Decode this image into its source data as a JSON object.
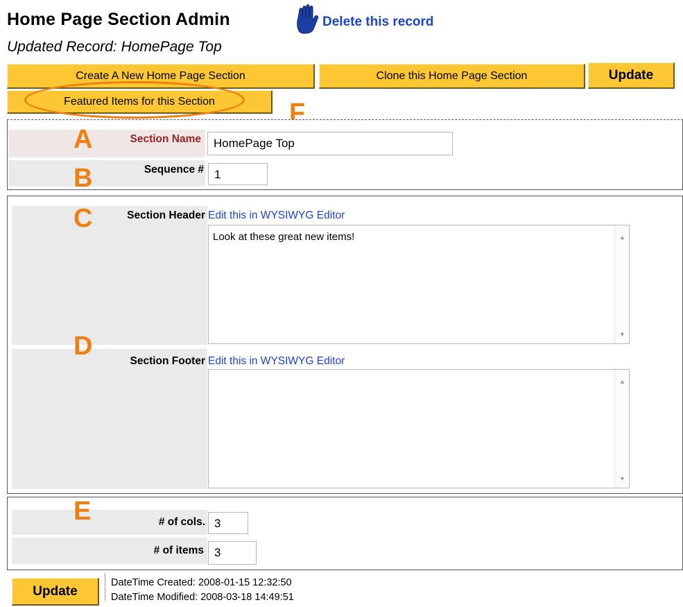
{
  "header": {
    "title": "Home Page Section Admin",
    "subtitle": "Updated Record: HomePage Top",
    "delete_label": "Delete this record",
    "delete_icon": "hand-stop-icon"
  },
  "toolbar": {
    "create_label": "Create A New Home Page Section",
    "clone_label": "Clone this Home Page Section",
    "update_label": "Update",
    "featured_label": "Featured Items for this Section"
  },
  "annotations": {
    "A": "A",
    "B": "B",
    "C": "C",
    "D": "D",
    "E": "E",
    "F": "F"
  },
  "form": {
    "section_name": {
      "label": "Section Name",
      "value": "HomePage Top"
    },
    "sequence": {
      "label": "Sequence #",
      "value": "1"
    },
    "section_header": {
      "label": "Section Header",
      "link": "Edit this in WYSIWYG Editor",
      "value": "Look at these great new items!"
    },
    "section_footer": {
      "label": "Section Footer",
      "link": "Edit this in WYSIWYG Editor",
      "value": ""
    },
    "cols": {
      "label": "# of cols.",
      "value": "3"
    },
    "items": {
      "label": "# of items",
      "value": "3"
    }
  },
  "footer": {
    "update_label": "Update",
    "created": "DateTime Created: 2008-01-15 12:32:50",
    "modified": "DateTime Modified: 2008-03-18 14:49:51"
  },
  "colors": {
    "button_yellow": "#fcc733",
    "annotation_orange": "#f07f10",
    "link_blue": "#1c44c9",
    "label_red": "#9b2323"
  }
}
